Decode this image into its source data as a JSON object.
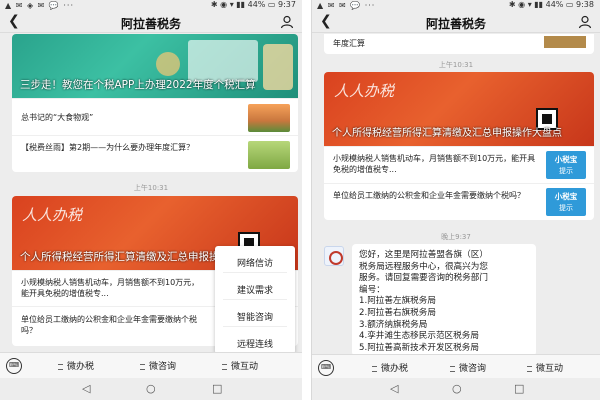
{
  "left": {
    "status": {
      "icons": "▲ ✉ ◈ ✉ 💬 ···",
      "right": "✱ ◉ ▾ ▮▮ 44% ▭ 9:37"
    },
    "header": {
      "title": "阿拉善税务"
    },
    "card1": {
      "banner_text": "三步走！教您在个税APP上办理2022年度个税汇算",
      "rows": [
        "总书记的“大食物观”",
        "【税费丝雨】第2期——为什么要办理年度汇算？"
      ]
    },
    "time1": "上午10:31",
    "card2": {
      "calligraphy": "人人办税",
      "banner_text": "个人所得税经营所得汇算清缴及汇总申报操作大盘点",
      "rows": [
        "小规模纳税人销售机动车，月销售额不到10万元，能开具免税的增值税专...",
        "单位给员工缴纳的公积金和企业年金需要缴纳个税吗？"
      ]
    },
    "menu": {
      "items": [
        "网络信访",
        "建议需求",
        "智能咨询",
        "远程连线"
      ]
    },
    "bottombar": {
      "keyboard": "⌨",
      "tabs": [
        "微办税",
        "微咨询",
        "微互动"
      ]
    },
    "navbar": {
      "back": "◁",
      "home": "○",
      "recent": "□"
    }
  },
  "right": {
    "status": {
      "icons": "▲ ✉ ✉ 💬 ···",
      "right": "✱ ◉ ▾ ▮▮ 44% ▭ 9:38"
    },
    "header": {
      "title": "阿拉善税务"
    },
    "top_text": "年度汇算",
    "time1": "上午10:31",
    "card": {
      "calligraphy": "人人办税",
      "banner_text": "个人所得税经营所得汇算清缴及汇总申报操作大盘点",
      "rows": [
        {
          "text": "小规模纳税人销售机动车，月销售额不到10万元，能开具免税的增值税专...",
          "badge_top": "小税宝",
          "badge_bottom": "提示"
        },
        {
          "text": "单位给员工缴纳的公积金和企业年金需要缴纳个税吗？",
          "badge_top": "小税宝",
          "badge_bottom": "提示"
        }
      ]
    },
    "time2": "晚上9:37",
    "message": {
      "lines": [
        "您好，这里是阿拉善盟各旗（区）",
        "税务局远程服务中心，很高兴为您",
        "服务。请回复需要咨询的税务部门",
        "编号：",
        "1.阿拉善左旗税务局",
        "2.阿拉善右旗税务局",
        "3.额济纳旗税务局",
        "4.孪井滩生态移民示范区税务局",
        "5.阿拉善高新技术开发区税务局"
      ]
    },
    "bottombar": {
      "keyboard": "⌨",
      "tabs": [
        "微办税",
        "微咨询",
        "微互动"
      ]
    },
    "navbar": {
      "back": "◁",
      "home": "○",
      "recent": "□"
    }
  }
}
